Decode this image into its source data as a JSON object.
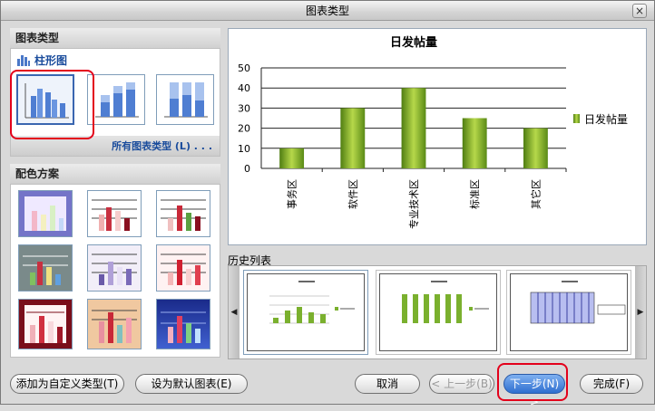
{
  "window": {
    "title": "图表类型",
    "close_glyph": "×"
  },
  "chart_types": {
    "header": "图表类型",
    "category": "柱形图",
    "all_types_link": "所有图表类型 (L) . . ."
  },
  "color_schemes": {
    "header": "配色方案"
  },
  "preview": {
    "chart_data": {
      "type": "bar",
      "title": "日发帖量",
      "categories": [
        "事务区",
        "软件区",
        "专业技术区",
        "标准区",
        "其它区"
      ],
      "values": [
        10,
        30,
        40,
        25,
        20
      ],
      "ylim": [
        0,
        50
      ],
      "yticks": [
        0,
        10,
        20,
        30,
        40,
        50
      ],
      "legend": "日发帖量",
      "legend_position": "right",
      "grid": true,
      "bar_color": "#7ab02e"
    }
  },
  "history": {
    "header": "历史列表",
    "prev_glyph": "◀",
    "next_glyph": "▶"
  },
  "buttons": {
    "add_custom": "添加为自定义类型(T)",
    "set_default": "设为默认图表(E)",
    "cancel": "取消",
    "back": "< 上一步(B)",
    "next": "下一步(N) >",
    "finish": "完成(F)"
  }
}
